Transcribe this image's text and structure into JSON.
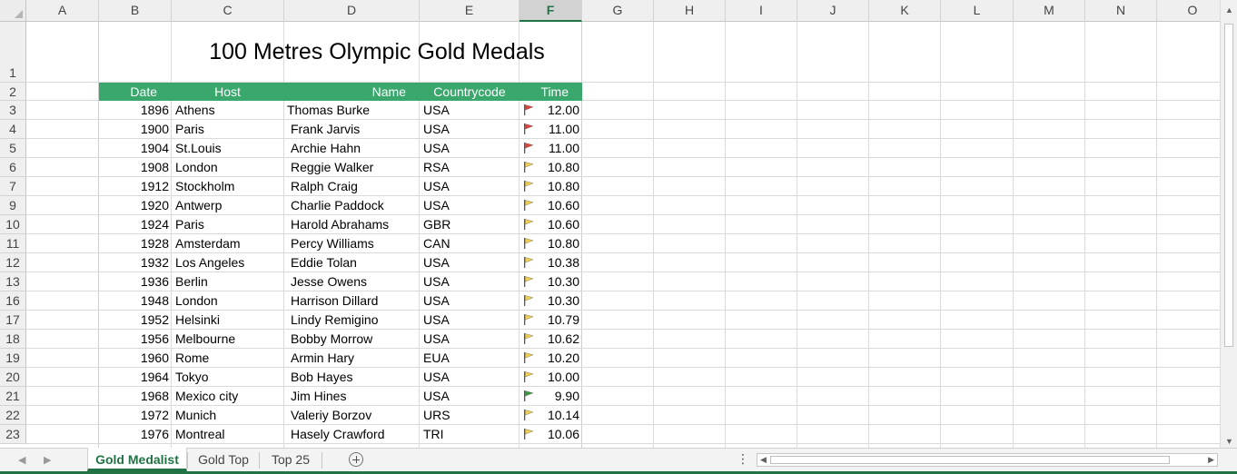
{
  "columns": [
    "A",
    "B",
    "C",
    "D",
    "E",
    "F",
    "G",
    "H",
    "I",
    "J",
    "K",
    "L",
    "M",
    "N",
    "O"
  ],
  "selected_column": "F",
  "rows": [
    "1",
    "2",
    "3",
    "4",
    "5",
    "6",
    "7",
    "9",
    "10",
    "11",
    "12",
    "13",
    "16",
    "17",
    "18",
    "19",
    "20",
    "21",
    "22",
    "23"
  ],
  "title": "100 Metres Olympic Gold Medals",
  "table_headers": {
    "date": "Date",
    "host": "Host",
    "name": "Name",
    "countrycode": "Countrycode",
    "time": "Time"
  },
  "table_rows": [
    {
      "date": "1896",
      "host": "Athens",
      "name": "Thomas Burke",
      "country": "USA",
      "time": "12.00",
      "flag": "red"
    },
    {
      "date": "1900",
      "host": "Paris",
      "name": "Frank Jarvis",
      "country": "USA",
      "time": "11.00",
      "flag": "red"
    },
    {
      "date": "1904",
      "host": "St.Louis",
      "name": "Archie Hahn",
      "country": "USA",
      "time": "11.00",
      "flag": "red"
    },
    {
      "date": "1908",
      "host": "London",
      "name": "Reggie Walker",
      "country": "RSA",
      "time": "10.80",
      "flag": "yellow"
    },
    {
      "date": "1912",
      "host": "Stockholm",
      "name": "Ralph Craig",
      "country": "USA",
      "time": "10.80",
      "flag": "yellow"
    },
    {
      "date": "1920",
      "host": "Antwerp",
      "name": "Charlie Paddock",
      "country": "USA",
      "time": "10.60",
      "flag": "yellow"
    },
    {
      "date": "1924",
      "host": "Paris",
      "name": "Harold Abrahams",
      "country": "GBR",
      "time": "10.60",
      "flag": "yellow"
    },
    {
      "date": "1928",
      "host": "Amsterdam",
      "name": "Percy Williams",
      "country": "CAN",
      "time": "10.80",
      "flag": "yellow"
    },
    {
      "date": "1932",
      "host": "Los Angeles",
      "name": "Eddie Tolan",
      "country": "USA",
      "time": "10.38",
      "flag": "yellow"
    },
    {
      "date": "1936",
      "host": "Berlin",
      "name": "Jesse Owens",
      "country": "USA",
      "time": "10.30",
      "flag": "yellow"
    },
    {
      "date": "1948",
      "host": "London",
      "name": "Harrison Dillard",
      "country": "USA",
      "time": "10.30",
      "flag": "yellow"
    },
    {
      "date": "1952",
      "host": "Helsinki",
      "name": "Lindy Remigino",
      "country": "USA",
      "time": "10.79",
      "flag": "yellow"
    },
    {
      "date": "1956",
      "host": "Melbourne",
      "name": "Bobby Morrow",
      "country": "USA",
      "time": "10.62",
      "flag": "yellow"
    },
    {
      "date": "1960",
      "host": "Rome",
      "name": "Armin Hary",
      "country": "EUA",
      "time": "10.20",
      "flag": "yellow"
    },
    {
      "date": "1964",
      "host": "Tokyo",
      "name": "Bob Hayes",
      "country": "USA",
      "time": "10.00",
      "flag": "yellow"
    },
    {
      "date": "1968",
      "host": "Mexico city",
      "name": "Jim Hines",
      "country": "USA",
      "time": "9.90",
      "flag": "green"
    },
    {
      "date": "1972",
      "host": "Munich",
      "name": "Valeriy Borzov",
      "country": "URS",
      "time": "10.14",
      "flag": "yellow"
    },
    {
      "date": "1976",
      "host": "Montreal",
      "name": "Hasely Crawford",
      "country": "TRI",
      "time": "10.06",
      "flag": "yellow"
    }
  ],
  "flag_colors": {
    "red": "#e0413a",
    "yellow": "#f2cf4a",
    "green": "#3a9a3a"
  },
  "header_color": "#3aa76d",
  "accent": "#217346",
  "tabs": [
    {
      "label": "Gold Medalist",
      "active": true
    },
    {
      "label": "Gold Top",
      "active": false
    },
    {
      "label": "Top 25",
      "active": false
    }
  ],
  "add_sheet_icon": "plus-circle-icon",
  "bottom_dots": "⋮"
}
